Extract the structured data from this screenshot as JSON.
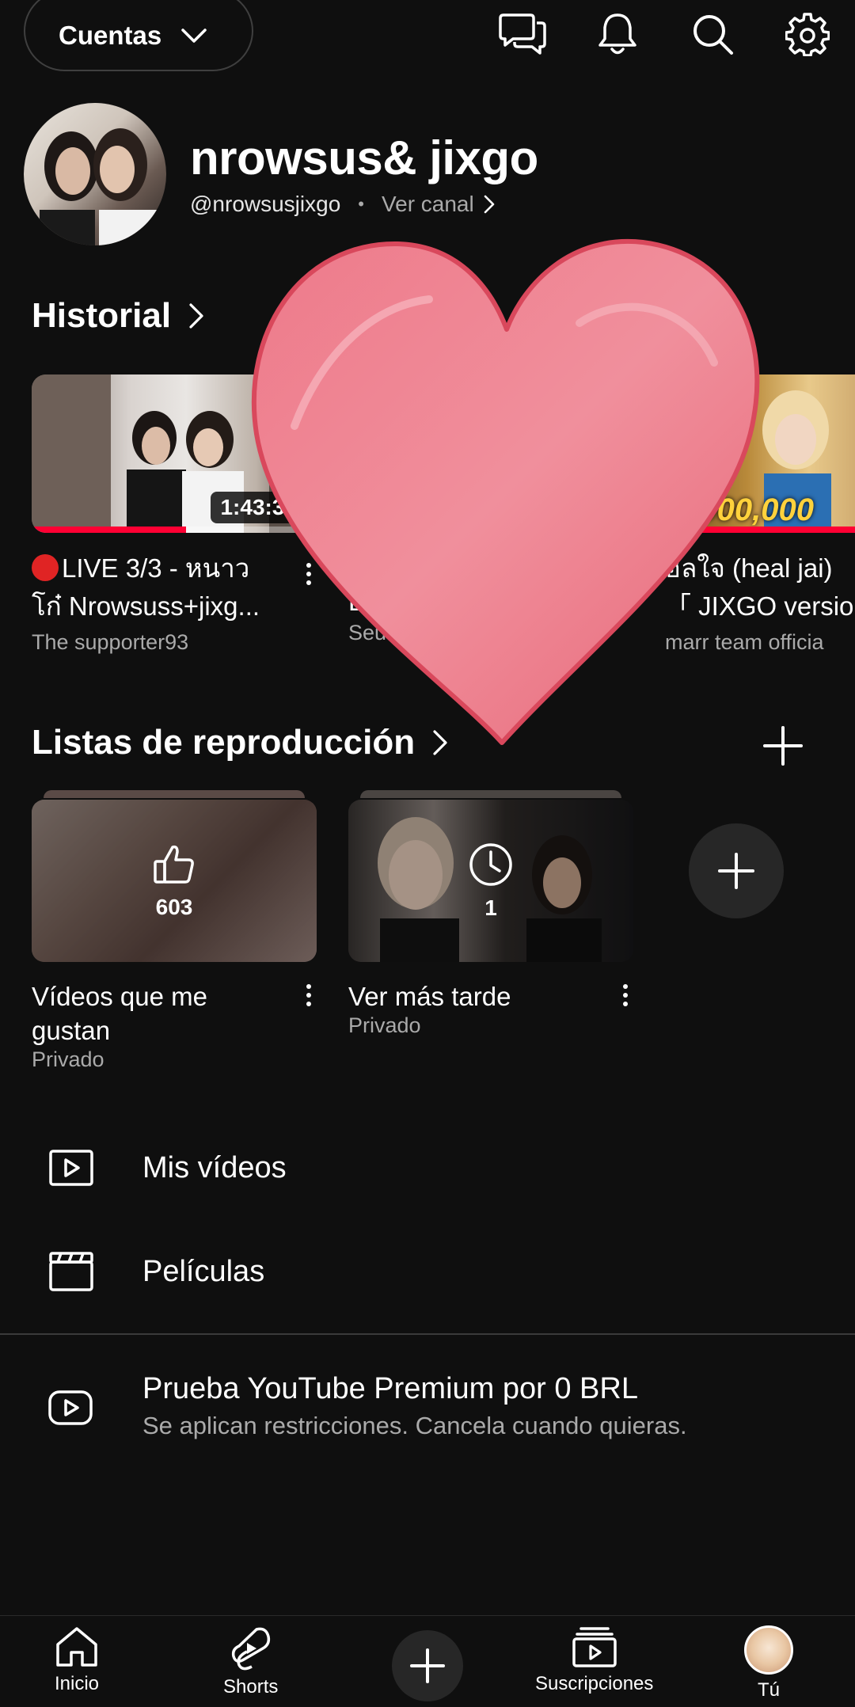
{
  "top_bar": {
    "accounts_label": "Cuentas",
    "icons": [
      "chat-icon",
      "bell-icon",
      "search-icon",
      "gear-icon"
    ]
  },
  "profile": {
    "name": "nrowsus& jixgo",
    "handle": "@nrowsusjixgo",
    "separator": "•",
    "view_channel": "Ver canal"
  },
  "history": {
    "title": "Historial",
    "items": [
      {
        "title_line1": "LIVE 3/3 - หนาว",
        "title_line2": "โก๋ Nrowsuss+jixg...",
        "channel": "The supporter93",
        "duration": "1:43:34",
        "progress": 0.55
      },
      {
        "title_line1": "D",
        "title_line2": "",
        "channel": "Seu L...",
        "duration": "",
        "progress": 0
      },
      {
        "title_line1": "ฮีลใจ (heal jai)",
        "title_line2": "「 JIXGO versio",
        "channel": "marr team officia",
        "overlay_text": "1,000,000",
        "progress": 1
      }
    ]
  },
  "playlists": {
    "title": "Listas de reproducción",
    "items": [
      {
        "title_line1": "Vídeos que me",
        "title_line2": "gustan",
        "privacy": "Privado",
        "count": "603",
        "icon": "thumbs-up-icon"
      },
      {
        "title_line1": "Ver más tarde",
        "title_line2": "",
        "privacy": "Privado",
        "count": "1",
        "icon": "clock-icon"
      }
    ]
  },
  "menu": {
    "my_videos": "Mis vídeos",
    "movies": "Películas",
    "premium_title": "Prueba YouTube Premium por 0 BRL",
    "premium_sub": "Se aplican restricciones. Cancela cuando quieras."
  },
  "bottom_nav": {
    "home": "Inicio",
    "shorts": "Shorts",
    "subscriptions": "Suscripciones",
    "you": "Tú"
  },
  "colors": {
    "background": "#0f0f0f",
    "progress_red": "#ff0033",
    "secondary_text": "#aaaaaa",
    "heart_sticker": "#e9677a"
  }
}
